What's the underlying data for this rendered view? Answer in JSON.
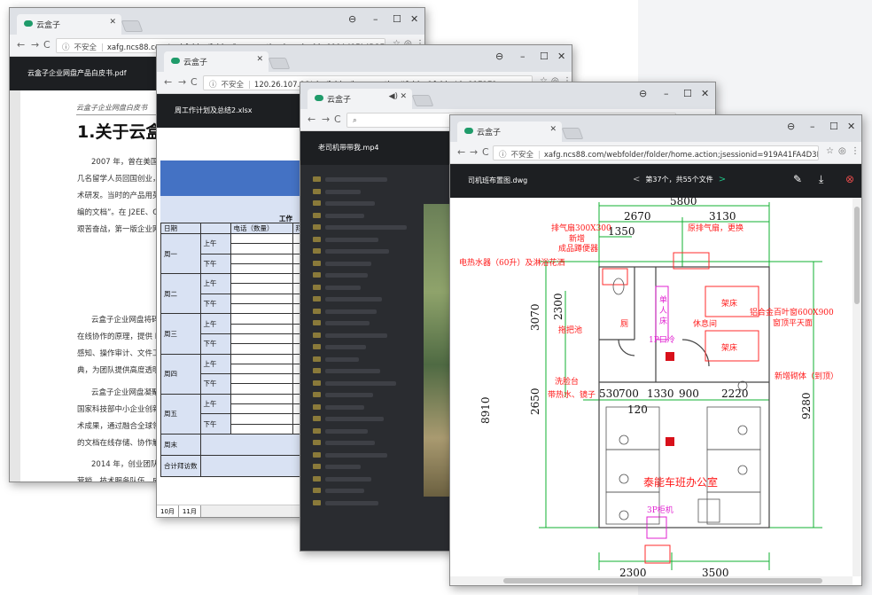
{
  "windows": {
    "pdf": {
      "tab_title": "云盒子",
      "url_secure_label": "不安全",
      "url": "xafg.ncs88.com/webfolder/folder/home.action;jsessionid=919A41FA4D3E8237EE770D...",
      "file_name": "云盒子企业网盘产品白皮书.pdf",
      "header_text": "云盒子企业网盘白皮书",
      "heading": "1.关于云盒子",
      "paragraphs": [
        "2007 年，曾在美国、",
        "几名留学人员回国创业，组",
        "术研发。当时的产品用英文",
        "编的文档”。在 J2EE、C+",
        "艰苦奋战，第一版企业网盘",
        "云盒子企业网盘将碎片",
        "在线协作的原理，提供 PC",
        "感知、操作审计、文件工作",
        "典，为团队提供高度透明、",
        "云盒子企业网盘凝聚了",
        "国家科技部中小企业创新基",
        "术成果，通过融合全球领先",
        "的文档在线存储、协作解决",
        "2014 年，创业团队获",
        "营销、技术服务队伍，成立"
      ]
    },
    "xlsx": {
      "tab_title": "云盒子",
      "url_secure_label": "不安全",
      "url": "120.26.107.86/yhz/folder/home.action#folder&folderId=117171",
      "file_name": "周工作计划及总结2.xlsx",
      "sheet_title": "工作",
      "columns": [
        "日期",
        "",
        "电话（数量）",
        "拜"
      ],
      "days": [
        "周一",
        "周二",
        "周三",
        "周四",
        "周五"
      ],
      "am": "上午",
      "pm": "下午",
      "weekend": "周末",
      "total": "合计拜访数",
      "sheet_tabs": [
        "10月",
        "11月"
      ]
    },
    "mp4": {
      "tab_title": "云盒子",
      "file_name": "老司机带带我.mp4"
    },
    "dwg": {
      "tab_title": "云盒子",
      "url_secure_label": "不安全",
      "url": "xafg.ncs88.com/webfolder/folder/home.action;jsessionid=919A41FA4D3E8237EE770D...",
      "file_name": "司机班布置图.dwg",
      "pager": "第37个，共55个文件",
      "drawing": {
        "dims_top": [
          "5800",
          "2670",
          "3130",
          "1350"
        ],
        "dims_bottom": [
          "2300",
          "3500"
        ],
        "dims_mid": [
          "530",
          "700",
          "1330",
          "900",
          "2220",
          "120"
        ],
        "dims_left": [
          "3070",
          "2300",
          "8910",
          "2650"
        ],
        "dims_right": [
          "9280"
        ],
        "labels_red": [
          "排气扇300X300",
          "新增",
          "成品蹲便器",
          "电热水器（60升）及淋浴花洒",
          "拖把池",
          "洗脸台",
          "带热水、镜子",
          "原排气扇，更换",
          "铝合金百叶窗600X900",
          "窗顶平天面",
          "新增砌体（到顶）",
          "架床",
          "架床",
          "休息间",
          "厕",
          "泰能车班办公室"
        ],
        "labels_magenta": [
          "单",
          "人",
          "床",
          "1P口冷",
          "3P柜机"
        ]
      }
    }
  },
  "icons": {
    "account": "account-icon",
    "minimize": "minimize-icon",
    "maximize": "maximize-icon",
    "close": "close-icon"
  }
}
